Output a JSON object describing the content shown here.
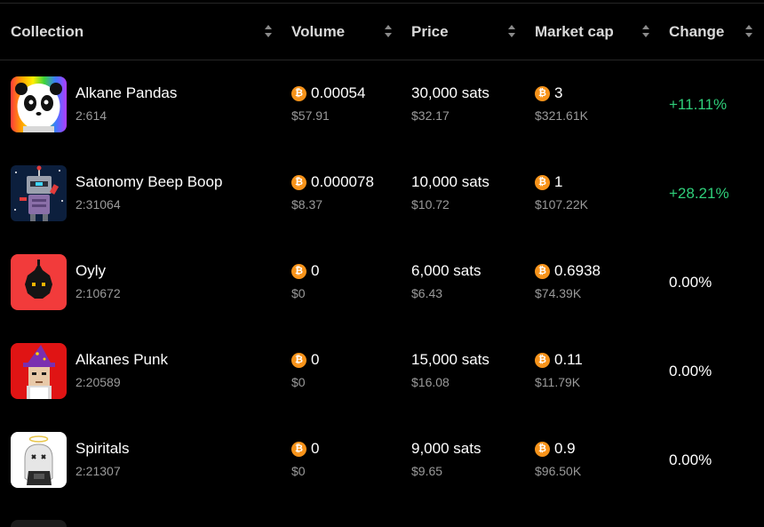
{
  "table": {
    "headers": {
      "collection": "Collection",
      "volume": "Volume",
      "price": "Price",
      "market_cap": "Market cap",
      "change": "Change"
    },
    "rows": [
      {
        "name": "Alkane Pandas",
        "id": "2:614",
        "volume_btc": "0.00054",
        "volume_usd": "$57.91",
        "price_sats": "30,000 sats",
        "price_usd": "$32.17",
        "mcap_btc": "3",
        "mcap_usd": "$321.61K",
        "change": "+11.11%",
        "change_color": "#2fcf7a"
      },
      {
        "name": "Satonomy Beep Boop",
        "id": "2:31064",
        "volume_btc": "0.000078",
        "volume_usd": "$8.37",
        "price_sats": "10,000 sats",
        "price_usd": "$10.72",
        "mcap_btc": "1",
        "mcap_usd": "$107.22K",
        "change": "+28.21%",
        "change_color": "#2fcf7a"
      },
      {
        "name": "Oyly",
        "id": "2:10672",
        "volume_btc": "0",
        "volume_usd": "$0",
        "price_sats": "6,000 sats",
        "price_usd": "$6.43",
        "mcap_btc": "0.6938",
        "mcap_usd": "$74.39K",
        "change": "0.00%",
        "change_color": "#ffffff"
      },
      {
        "name": "Alkanes Punk",
        "id": "2:20589",
        "volume_btc": "0",
        "volume_usd": "$0",
        "price_sats": "15,000 sats",
        "price_usd": "$16.08",
        "mcap_btc": "0.11",
        "mcap_usd": "$11.79K",
        "change": "0.00%",
        "change_color": "#ffffff"
      },
      {
        "name": "Spiritals",
        "id": "2:21307",
        "volume_btc": "0",
        "volume_usd": "$0",
        "price_sats": "9,000 sats",
        "price_usd": "$9.65",
        "mcap_btc": "0.9",
        "mcap_usd": "$96.50K",
        "change": "0.00%",
        "change_color": "#ffffff"
      }
    ]
  },
  "icons": {
    "currency": "bitcoin-icon",
    "sort": "sort-icon",
    "btc_symbol": "₿"
  },
  "colors": {
    "positive": "#2fcf7a",
    "bitcoin": "#f7931a",
    "muted_text": "#9a9a9a"
  }
}
